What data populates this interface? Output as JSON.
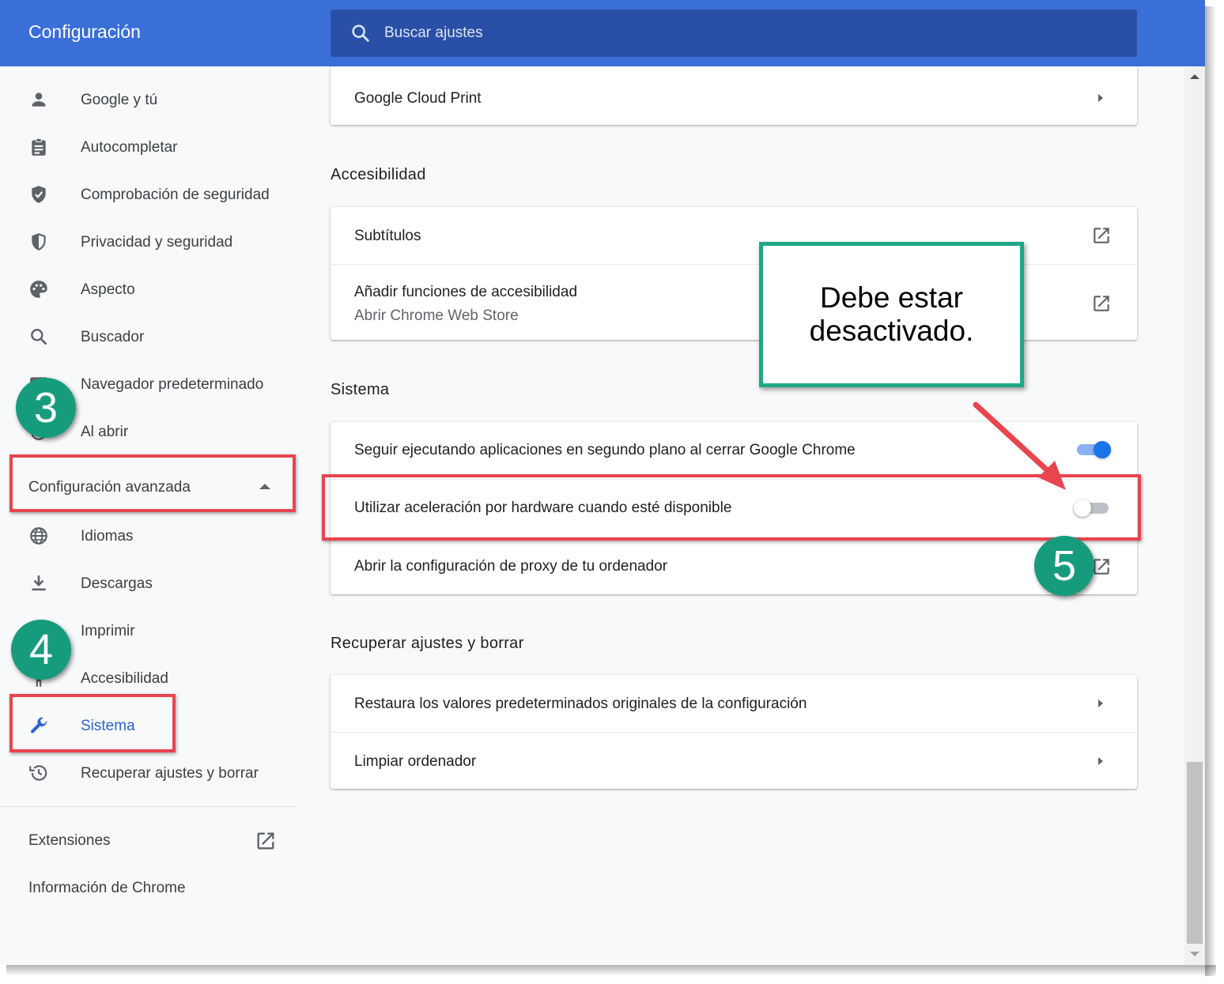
{
  "header": {
    "title": "Configuración",
    "search_placeholder": "Buscar ajustes",
    "search_value": ""
  },
  "sidebar": {
    "items": [
      {
        "label": "Google y tú",
        "icon": "person-icon"
      },
      {
        "label": "Autocompletar",
        "icon": "clipboard-icon"
      },
      {
        "label": "Comprobación de seguridad",
        "icon": "shield-check-icon"
      },
      {
        "label": "Privacidad y seguridad",
        "icon": "shield-half-icon"
      },
      {
        "label": "Aspecto",
        "icon": "palette-icon"
      },
      {
        "label": "Buscador",
        "icon": "search-icon"
      },
      {
        "label": "Navegador predeterminado",
        "icon": "browser-icon"
      },
      {
        "label": "Al abrir",
        "icon": "power-icon"
      }
    ],
    "advanced_label": "Configuración avanzada",
    "advanced_items": [
      {
        "label": "Idiomas",
        "icon": "globe-icon"
      },
      {
        "label": "Descargas",
        "icon": "download-icon"
      },
      {
        "label": "Imprimir",
        "icon": "print-icon"
      },
      {
        "label": "Accesibilidad",
        "icon": "accessibility-icon"
      },
      {
        "label": "Sistema",
        "icon": "wrench-icon",
        "active": true
      },
      {
        "label": "Recuperar ajustes y borrar",
        "icon": "history-icon"
      }
    ],
    "footer": {
      "extensions": "Extensiones",
      "about": "Información de Chrome"
    }
  },
  "main": {
    "cloud_print": "Google Cloud Print",
    "accessibility": {
      "title": "Accesibilidad",
      "captions": "Subtítulos",
      "add_features": "Añadir funciones de accesibilidad",
      "add_features_sub": "Abrir Chrome Web Store"
    },
    "system": {
      "title": "Sistema",
      "background_apps": "Seguir ejecutando aplicaciones en segundo plano al cerrar Google Chrome",
      "background_apps_on": true,
      "hardware_accel": "Utilizar aceleración por hardware cuando esté disponible",
      "hardware_accel_on": false,
      "proxy": "Abrir la configuración de proxy de tu ordenador"
    },
    "reset": {
      "title": "Recuperar ajustes y borrar",
      "restore": "Restaura los valores predeterminados originales de la configuración",
      "cleanup": "Limpiar ordenador"
    }
  },
  "annotations": {
    "step3": "3",
    "step4": "4",
    "step5": "5",
    "callout": "Debe estar desactivado."
  },
  "colors": {
    "header": "#3b6fd8",
    "search_bg": "#2a4fa6",
    "active": "#2f63d6",
    "highlight": "#e8454f",
    "badge": "#169c7d",
    "toggle_on": "#1a73e8"
  }
}
